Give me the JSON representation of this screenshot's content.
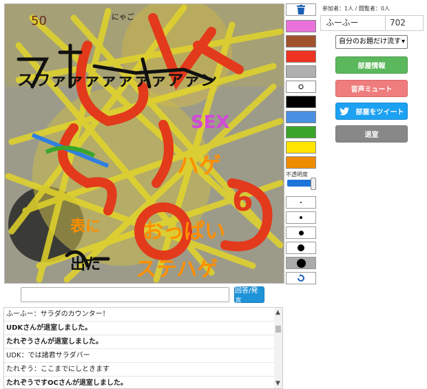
{
  "participants_text": "参加者：1人 / 闘覧者：0人",
  "user": {
    "name": "ふーふー",
    "score": "702"
  },
  "select": {
    "value": "自分のお題だけ流す"
  },
  "buttons": {
    "room_info": "部屋情報",
    "mute": "音声ミュート",
    "tweet": "部屋をツイート",
    "leave": "退室",
    "send": "回答/発言"
  },
  "opacity_label": "不透明度",
  "opacity_level": 0.95,
  "palette": [
    "#e872d9",
    "#a0522d",
    "#ee3322",
    "#b0b0b0",
    "#ffffff",
    "#000000",
    "#4a90e2",
    "#3aa52a",
    "#ffe400",
    "#f08c00"
  ],
  "icons": {
    "trash": "trash-icon",
    "undo": "undo-icon",
    "tweet": "twitter-bird-icon"
  },
  "chat_input": {
    "placeholder": ""
  },
  "chat": [
    {
      "text": "ふーふー：サラダのカウンター！"
    },
    {
      "text": "UDKさんが退室しました。"
    },
    {
      "text": "たれぞうさんが退室しました。"
    },
    {
      "text": "UDK：では諸君サラダバー"
    },
    {
      "text": "たれぞう：ここまでにしときます"
    },
    {
      "text": "たれぞうですOCさんが退室しました。"
    }
  ],
  "canvas_text": [
    "にゃご",
    "スワァァァァァァァアァン",
    "SEX",
    "ハゲ",
    "おっぱい",
    "ステハゲ",
    "表に",
    "出た",
    "50",
    "6"
  ]
}
